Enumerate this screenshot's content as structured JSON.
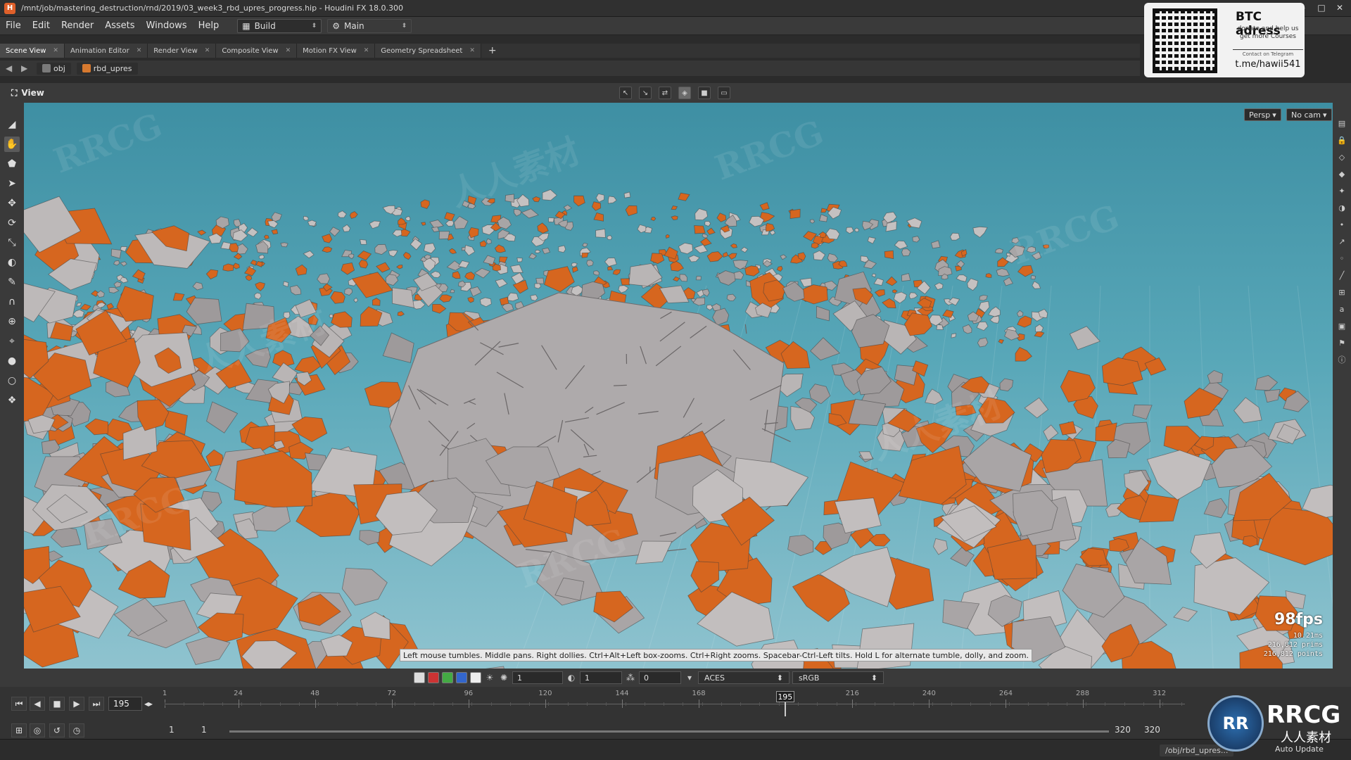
{
  "window": {
    "title": "/mnt/job/mastering_destruction/rnd/2019/03_week3_rbd_upres_progress.hip - Houdini FX 18.0.300",
    "logo_text": "RRCG"
  },
  "menu": {
    "items": [
      "File",
      "Edit",
      "Render",
      "Assets",
      "Windows",
      "Help"
    ],
    "desktop": "Build",
    "main": "Main"
  },
  "tabs": [
    {
      "label": "Scene View",
      "active": true
    },
    {
      "label": "Animation Editor",
      "active": false
    },
    {
      "label": "Render View",
      "active": false
    },
    {
      "label": "Composite View",
      "active": false
    },
    {
      "label": "Motion FX View",
      "active": false
    },
    {
      "label": "Geometry Spreadsheet",
      "active": false
    }
  ],
  "path": {
    "obj": "obj",
    "node": "rbd_upres"
  },
  "btc": {
    "title": "BTC adress",
    "sub": "donate and help us get more Courses",
    "contact": "Contact on Telegram",
    "handle": "t.me/hawii541"
  },
  "view": {
    "label": "View",
    "persp": "Persp",
    "cam": "No cam",
    "fps": "98fps",
    "stats": [
      "10.21ms",
      "216,812  prims",
      "216,812  points"
    ],
    "hint": "Left mouse tumbles. Middle pans. Right dollies. Ctrl+Alt+Left box-zooms. Ctrl+Right zooms. Spacebar-Ctrl-Left tilts. Hold L for alternate tumble, dolly, and zoom."
  },
  "display": {
    "field1": "1",
    "field2": "1",
    "field3": "0",
    "colorspace": "ACES",
    "lut": "sRGB"
  },
  "playbar": {
    "frame": "195",
    "cursor_frame": 195,
    "range_start_frame": 1,
    "range_end_frame": 320,
    "ticks": [
      "1",
      "24",
      "48",
      "72",
      "96",
      "120",
      "144",
      "168",
      "195",
      "216",
      "240",
      "264",
      "288",
      "312"
    ],
    "start": "1",
    "start2": "1",
    "end": "320",
    "end2": "320"
  },
  "status": {
    "path": "/obj/rbd_upres...",
    "update": "Auto Update"
  },
  "watermark": {
    "logo": "RR",
    "text": "RRCG",
    "sub": "人人素材",
    "repeat": "RRCG",
    "repeat_cn": "人人素材"
  },
  "colors": {
    "orange": "#d6661f",
    "concrete": "#b4b0b0",
    "sky": "#58a7b8"
  }
}
